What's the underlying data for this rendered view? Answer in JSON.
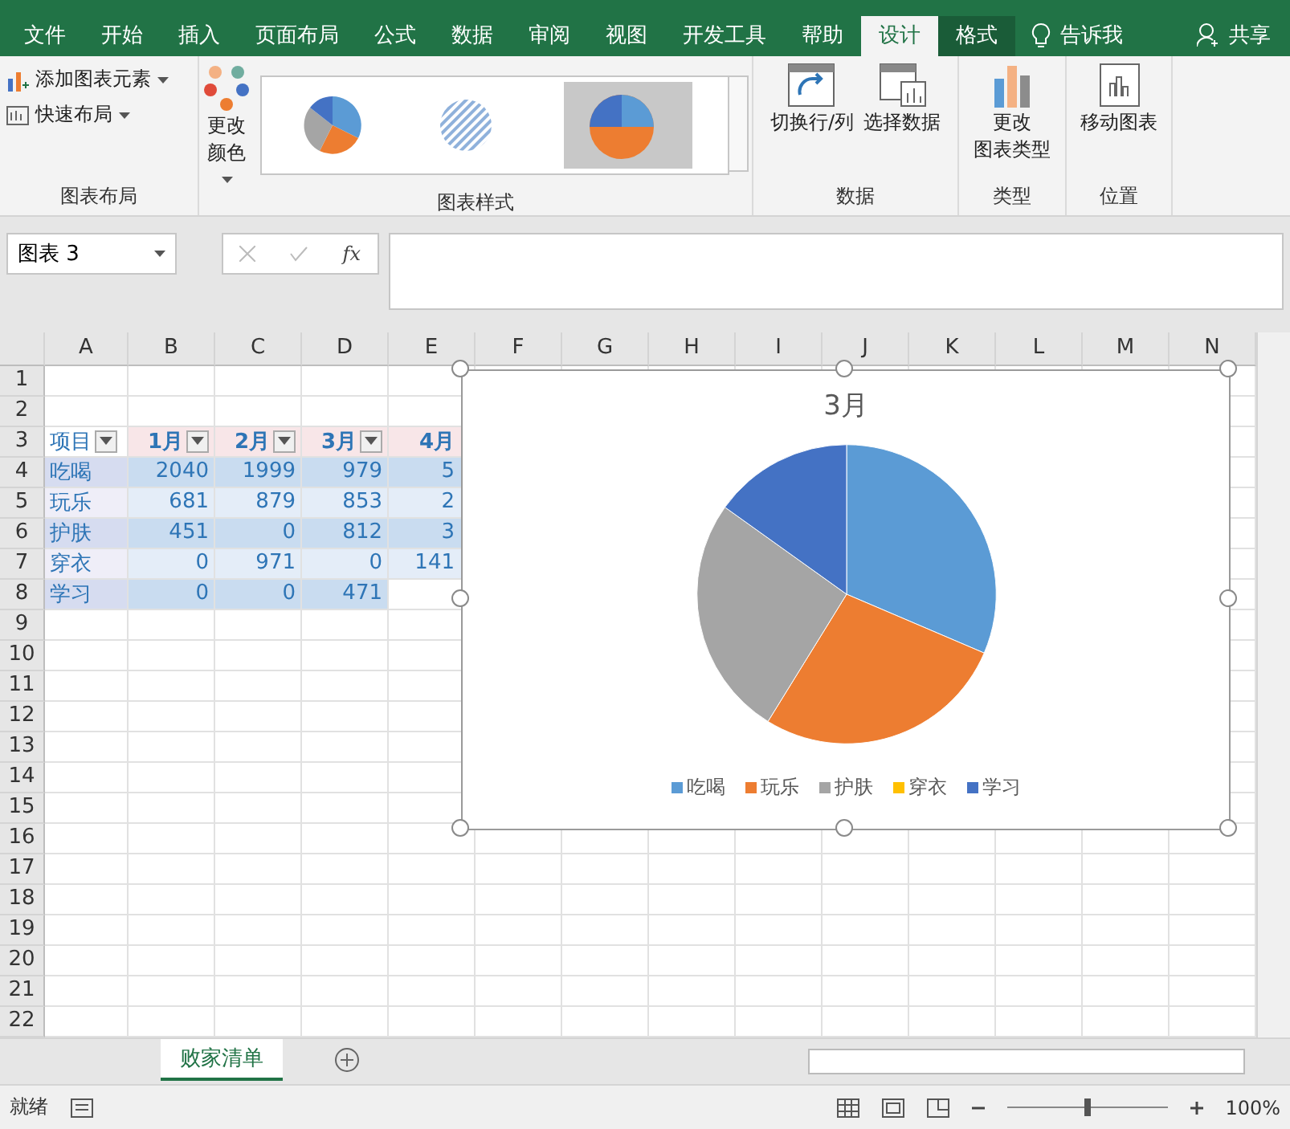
{
  "menu_tabs": [
    {
      "label": "文件",
      "selected": false
    },
    {
      "label": "开始",
      "selected": false
    },
    {
      "label": "插入",
      "selected": false
    },
    {
      "label": "页面布局",
      "selected": false
    },
    {
      "label": "公式",
      "selected": false
    },
    {
      "label": "数据",
      "selected": false
    },
    {
      "label": "审阅",
      "selected": false
    },
    {
      "label": "视图",
      "selected": false
    },
    {
      "label": "开发工具",
      "selected": false
    },
    {
      "label": "帮助",
      "selected": false
    },
    {
      "label": "设计",
      "selected": true
    },
    {
      "label": "格式",
      "selected": false
    }
  ],
  "tell_me": "告诉我",
  "share": "共享",
  "ribbon": {
    "layout_group": {
      "label": "图表布局",
      "add_element": "添加图表元素",
      "quick_layout": "快速布局"
    },
    "styles_group": {
      "label": "图表样式",
      "colors": [
        "更改",
        "颜色"
      ]
    },
    "data_group": {
      "label": "数据",
      "switch": "切换行/列",
      "select": "选择数据"
    },
    "type_group": {
      "label": "类型",
      "change": [
        "更改",
        "图表类型"
      ]
    },
    "location_group": {
      "label": "位置",
      "move": "移动图表"
    }
  },
  "name_box": "图表 3",
  "fx": "fx",
  "columns": [
    "A",
    "B",
    "C",
    "D",
    "E",
    "F",
    "G",
    "H",
    "I",
    "J",
    "K",
    "L",
    "M",
    "N"
  ],
  "rows": [
    "1",
    "2",
    "3",
    "4",
    "5",
    "6",
    "7",
    "8",
    "9",
    "10",
    "11",
    "12",
    "13",
    "14",
    "15",
    "16",
    "17",
    "18",
    "19",
    "20",
    "21",
    "22"
  ],
  "table": {
    "headers": [
      {
        "label": "项目",
        "filter": true
      },
      {
        "label": "1月",
        "filter": true
      },
      {
        "label": "2月",
        "filter": true
      },
      {
        "label": "3月",
        "filter": true
      },
      {
        "label": "4月",
        "filter": false
      }
    ],
    "rows": [
      [
        "吃喝",
        "2040",
        "1999",
        "979",
        "5"
      ],
      [
        "玩乐",
        "681",
        "879",
        "853",
        "2"
      ],
      [
        "护肤",
        "451",
        "0",
        "812",
        "3"
      ],
      [
        "穿衣",
        "0",
        "971",
        "0",
        "141"
      ],
      [
        "学习",
        "0",
        "0",
        "471",
        ""
      ]
    ]
  },
  "chart": {
    "title": "3月",
    "legend": [
      {
        "label": "吃喝",
        "color": "#5b9bd5"
      },
      {
        "label": "玩乐",
        "color": "#ed7d31"
      },
      {
        "label": "护肤",
        "color": "#a5a5a5"
      },
      {
        "label": "穿衣",
        "color": "#ffc000"
      },
      {
        "label": "学习",
        "color": "#4472c4"
      }
    ],
    "chart_data": {
      "type": "pie",
      "values": [
        31.43,
        27.38,
        26.07,
        0,
        15.12
      ]
    }
  },
  "sheet_tabs": [
    {
      "label": "败家清单",
      "selected": true
    }
  ],
  "status": "就绪",
  "zoom": {
    "level": 0.5,
    "reading": "100%"
  }
}
